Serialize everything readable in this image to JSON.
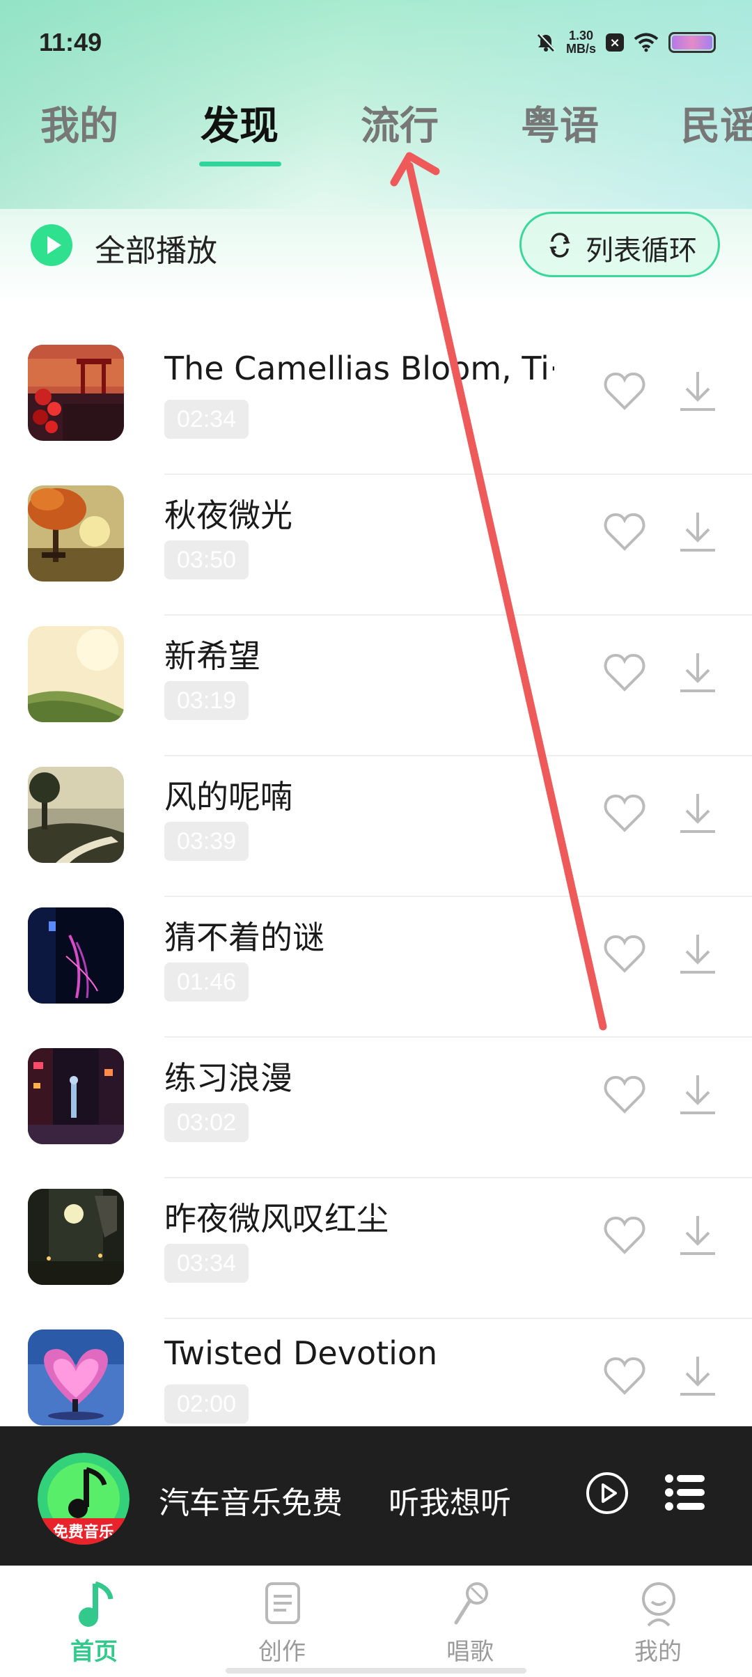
{
  "status_bar": {
    "time": "11:49",
    "net_speed_value": "1.30",
    "net_speed_unit": "MB/s",
    "icons": [
      "bell-muted-icon",
      "x-box-icon",
      "wifi-icon",
      "battery-icon"
    ]
  },
  "tabs": [
    {
      "label": "我的",
      "active": false
    },
    {
      "label": "发现",
      "active": true
    },
    {
      "label": "流行",
      "active": false
    },
    {
      "label": "粤语",
      "active": false
    },
    {
      "label": "民谣",
      "active": false
    }
  ],
  "controls": {
    "play_all_label": "全部播放",
    "loop_label": "列表循环"
  },
  "songs": [
    {
      "title": "The Camellias Bloom, Ti···",
      "duration": "02:34"
    },
    {
      "title": "秋夜微光",
      "duration": "03:50"
    },
    {
      "title": "新希望",
      "duration": "03:19"
    },
    {
      "title": "风的呢喃",
      "duration": "03:39"
    },
    {
      "title": "猜不着的谜",
      "duration": "01:46"
    },
    {
      "title": "练习浪漫",
      "duration": "03:02"
    },
    {
      "title": "昨夜微风叹红尘",
      "duration": "03:34"
    },
    {
      "title": "Twisted Devotion",
      "duration": "02:00"
    }
  ],
  "mini_player": {
    "title": "汽车音乐免费",
    "subtitle": "听我想听",
    "logo_text": "免费音乐"
  },
  "bottom_nav": [
    {
      "label": "首页",
      "icon": "music-note-icon",
      "active": true
    },
    {
      "label": "创作",
      "icon": "document-icon",
      "active": false
    },
    {
      "label": "唱歌",
      "icon": "microphone-icon",
      "active": false
    },
    {
      "label": "我的",
      "icon": "profile-icon",
      "active": false
    }
  ],
  "colors": {
    "accent": "#2fd59b",
    "header_gradient_top": "#a8ebcf",
    "annotation_arrow": "#ee5a5a",
    "mini_player_bg": "#1f1f1f"
  }
}
